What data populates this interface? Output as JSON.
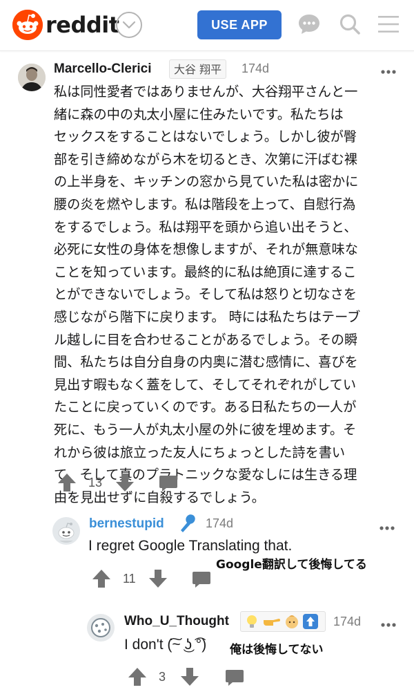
{
  "header": {
    "logo_text": "reddit",
    "use_app_label": "USE APP",
    "brand_color": "#ff4500",
    "button_color": "#3372d2",
    "icons": [
      "reddit-snoo-icon",
      "chevron-down-icon",
      "chat-icon",
      "search-icon",
      "menu-icon"
    ]
  },
  "comments": [
    {
      "username": "Marcello-Clerici",
      "flair": "大谷 翔平",
      "time": "174d",
      "body_lines": [
        "私は同性愛者ではありませんが、大谷翔平さんと一",
        "緒に森の中の丸太小屋に住みたいです。私たちは",
        "セックスをすることはないでしょう。しかし彼が臀",
        "部を引き締めながら木を切るとき、次第に汗ばむ裸",
        "の上半身を、キッチンの窓から見ていた私は密かに",
        "腰の炎を燃やします。私は階段を上って、自慰行為",
        "をするでしょう。私は翔平を頭から追い出そうと、",
        "必死に女性の身体を想像しますが、それが無意味な",
        "ことを知っています。最終的に私は絶頂に達するこ",
        "とができないでしょう。そして私は怒りと切なさを",
        "感じながら階下に戻ります。 時には私たちはテーブ",
        "ル越しに目を合わせることがあるでしょう。その瞬",
        "間、私たちは自分自身の内奥に潜む感情に、喜びを",
        "見出す暇もなく蓋をして、そしてそれぞれがしてい",
        "たことに戻っていくのです。ある日私たちの一人が",
        "死に、もう一人が丸太小屋の外に彼を埋めます。そ",
        "れから彼は旅立った友人にちょっとした詩を書い",
        "て、そして真のプラトニックな愛なしには生きる理",
        "由を見出せずに自殺するでしょう。"
      ],
      "votes": "13"
    },
    {
      "username": "bernestupid",
      "flair_icon": "microphone-icon",
      "time": "174d",
      "body": "I regret Google Translating that.",
      "caption": "Google翻訳して後悔してる",
      "votes": "11",
      "username_color": "#3a8fd8"
    },
    {
      "username": "Who_U_Thought",
      "flair_emojis": [
        "light-bulb-icon",
        "pointing-hand-icon",
        "baby-face-icon",
        "up-arrow-icon"
      ],
      "time": "174d",
      "body": "I don't (͠~ ͜ʖ ͡°)",
      "caption": "俺は後悔してない",
      "votes": "3"
    }
  ]
}
